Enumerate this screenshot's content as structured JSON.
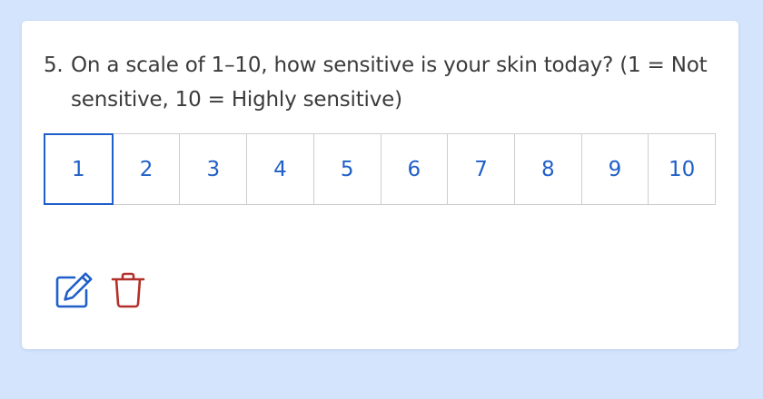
{
  "question": {
    "number": "5.",
    "text_line1": "On a scale of 1–10, how sensitive is your skin today? (1 = Not",
    "text_line2": "sensitive, 10 = Highly sensitive)"
  },
  "scale": {
    "options": [
      "1",
      "2",
      "3",
      "4",
      "5",
      "6",
      "7",
      "8",
      "9",
      "10"
    ],
    "selected": "1"
  },
  "actions": {
    "edit_icon": "edit-icon",
    "delete_icon": "trash-icon"
  },
  "colors": {
    "background": "#d3e4fc",
    "accent": "#1f5fc8",
    "delete": "#b3302a",
    "text": "#3b3b3b"
  }
}
